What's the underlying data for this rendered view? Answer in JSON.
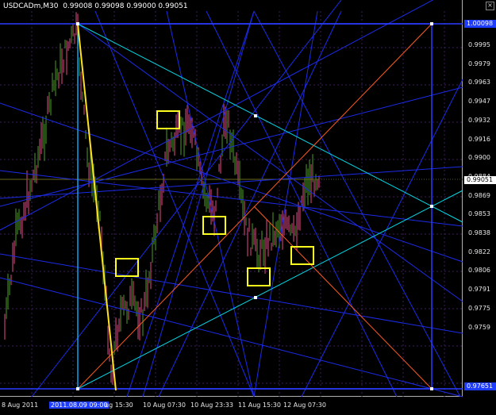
{
  "header": {
    "symbol": "USDCADm,M30",
    "ohlc": "0.99008 0.99098 0.99000 0.99051"
  },
  "price_axis": {
    "ticks": [
      "0.9995",
      "0.9979",
      "0.9963",
      "0.9947",
      "0.9932",
      "0.9916",
      "0.9900",
      "0.9884",
      "0.9869",
      "0.9853",
      "0.9838",
      "0.9822",
      "0.9806",
      "0.9791",
      "0.9775",
      "0.9759"
    ],
    "tags": {
      "top": "1.00098",
      "current": "0.99051",
      "bottom": "0.97651"
    }
  },
  "time_axis": {
    "labels": [
      "8 Aug 2011",
      "ug 15:30",
      "10 Aug 07:30",
      "10 Aug 23:33",
      "11 Aug 15:30",
      "12 Aug 07:30"
    ],
    "cursor_label": "2011.08.09 09:00"
  },
  "colors": {
    "background": "#000000",
    "bull_candle": "#3a7a1e",
    "bear_candle": "#b03a6a",
    "fan_blue": "#1c2be8",
    "triangle": "#00d7e6",
    "diag_orange": "#ff5a1e",
    "trend_yellow": "#ffe21e",
    "marker_box": "#ffff1e"
  }
}
